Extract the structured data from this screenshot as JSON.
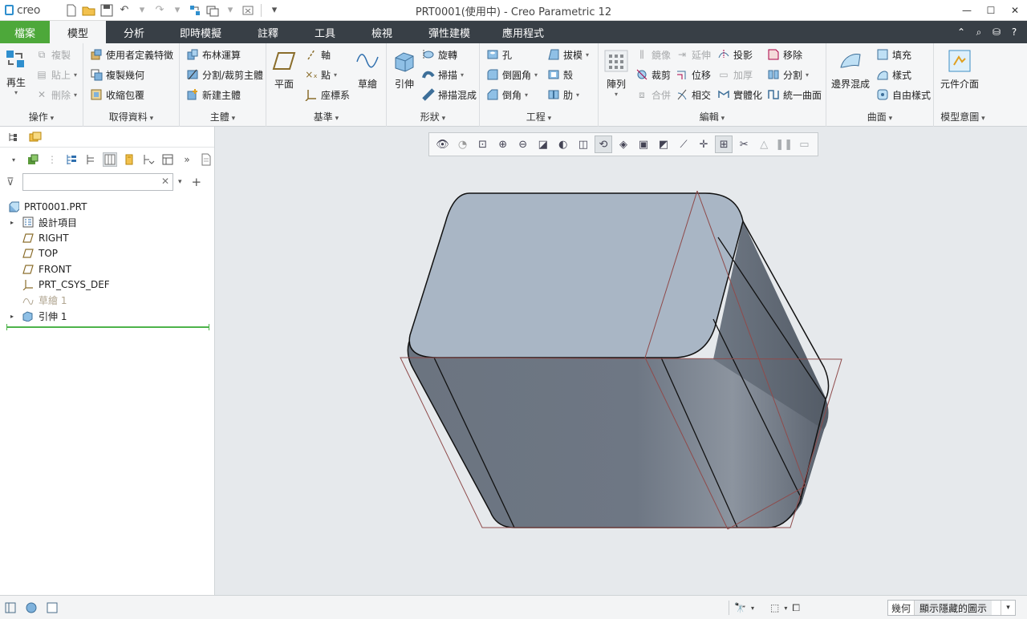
{
  "titlebar": {
    "logo": "creo",
    "title": "PRT0001(使用中) - Creo Parametric 12",
    "quick_access": [
      "new-icon",
      "open-icon",
      "save-icon",
      "undo-icon",
      "redo-icon",
      "regenerate-icon",
      "windows-icon",
      "close-window-icon",
      "customize-icon"
    ]
  },
  "tabs": {
    "file": "檔案",
    "items": [
      "模型",
      "分析",
      "即時模擬",
      "註釋",
      "工具",
      "檢視",
      "彈性建模",
      "應用程式"
    ],
    "active": "模型"
  },
  "ribbon": {
    "operations": {
      "label": "操作",
      "regenerate": "再生",
      "copy": "複製",
      "paste": "貼上",
      "delete": "刪除"
    },
    "get_data": {
      "label": "取得資料",
      "udf": "使用者定義特徵",
      "copy_geom": "複製幾何",
      "shrinkwrap": "收縮包覆"
    },
    "body": {
      "label": "主體",
      "boolean": "布林運算",
      "split": "分割/裁剪主體",
      "new_body": "新建主體"
    },
    "datum": {
      "label": "基準",
      "plane": "平面",
      "axis": "軸",
      "point": "點",
      "csys": "座標系",
      "sketch": "草繪"
    },
    "shapes": {
      "label": "形狀",
      "extrude": "引伸",
      "revolve": "旋轉",
      "sweep": "掃描",
      "swept_blend": "掃描混成"
    },
    "engineering": {
      "label": "工程",
      "hole": "孔",
      "round": "倒圓角",
      "chamfer": "倒角",
      "draft": "拔模",
      "shell": "殼",
      "rib": "肋"
    },
    "editing": {
      "label": "編輯",
      "pattern": "陣列",
      "mirror": "鏡像",
      "extend": "延伸",
      "project": "投影",
      "trim": "裁剪",
      "offset": "位移",
      "thicken": "加厚",
      "merge": "合併",
      "intersect": "相交",
      "solidify": "實體化",
      "remove": "移除",
      "split": "分割",
      "unify_surf": "統一曲面"
    },
    "surfaces": {
      "label": "曲面",
      "boundary_blend": "邊界混成",
      "fill": "填充",
      "style": "樣式",
      "freestyle": "自由樣式"
    },
    "model_intent": {
      "label": "模型意圖",
      "component_interface": "元件介面"
    }
  },
  "left_panel": {
    "search_placeholder": "",
    "tree": [
      {
        "label": "PRT0001.PRT",
        "icon": "part-icon",
        "expand": false,
        "dim": false
      },
      {
        "label": "設計項目",
        "icon": "design-items-icon",
        "expand": true,
        "dim": false
      },
      {
        "label": "RIGHT",
        "icon": "datum-plane-icon",
        "expand": false,
        "dim": false
      },
      {
        "label": "TOP",
        "icon": "datum-plane-icon",
        "expand": false,
        "dim": false
      },
      {
        "label": "FRONT",
        "icon": "datum-plane-icon",
        "expand": false,
        "dim": false
      },
      {
        "label": "PRT_CSYS_DEF",
        "icon": "csys-icon",
        "expand": false,
        "dim": false
      },
      {
        "label": "草繪 1",
        "icon": "sketch-icon",
        "expand": false,
        "dim": true
      },
      {
        "label": "引伸 1",
        "icon": "extrude-icon",
        "expand": true,
        "dim": false
      }
    ]
  },
  "status": {
    "filter_label": "幾何",
    "filter_value": "顯示隱藏的圖示"
  },
  "colors": {
    "file_tab": "#4da83a",
    "tab_bar": "#383f46",
    "model_face": "#a9b6c5",
    "datum_plane": "#9a4a4a"
  }
}
